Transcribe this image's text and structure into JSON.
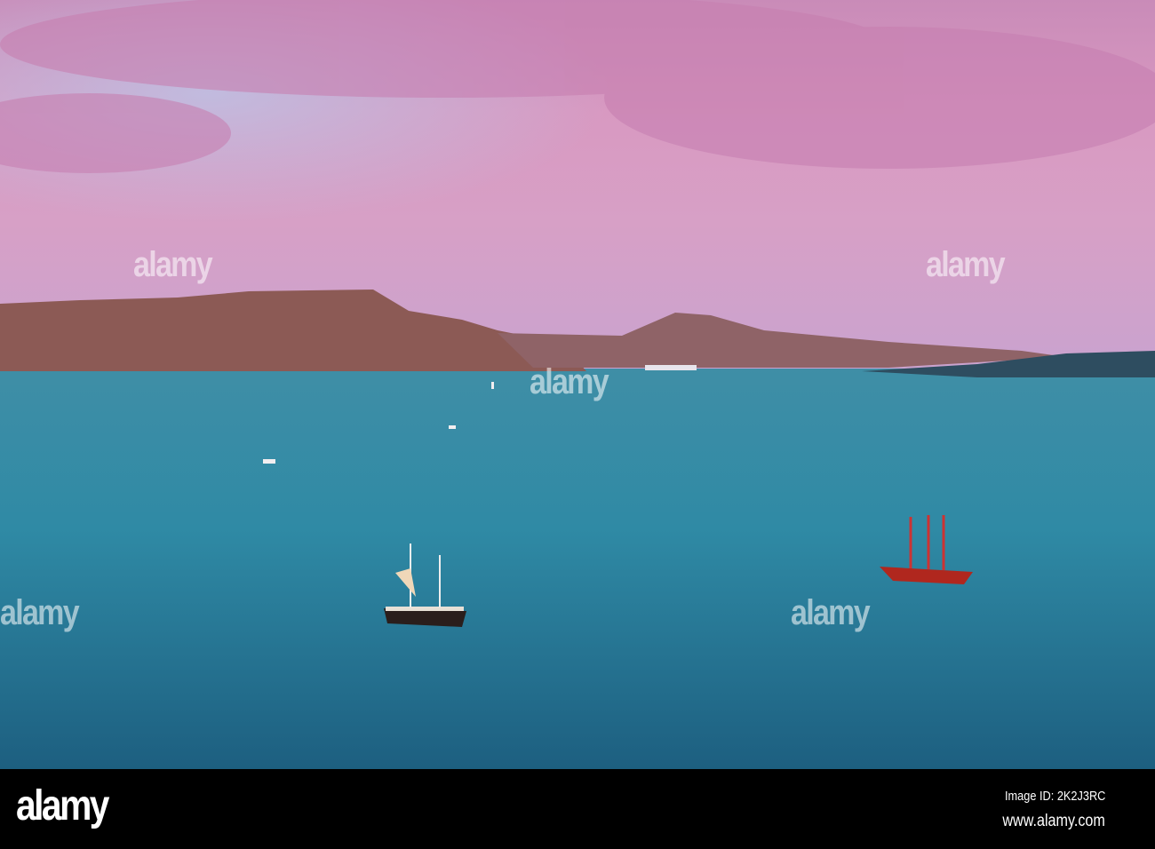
{
  "photo": {
    "subject": "Sailing ships in sea at sunset"
  },
  "watermark": {
    "text": "alamy"
  },
  "footer": {
    "logo": "alamy",
    "image_id": "Image ID: 2K2J3RC",
    "url": "www.alamy.com"
  }
}
